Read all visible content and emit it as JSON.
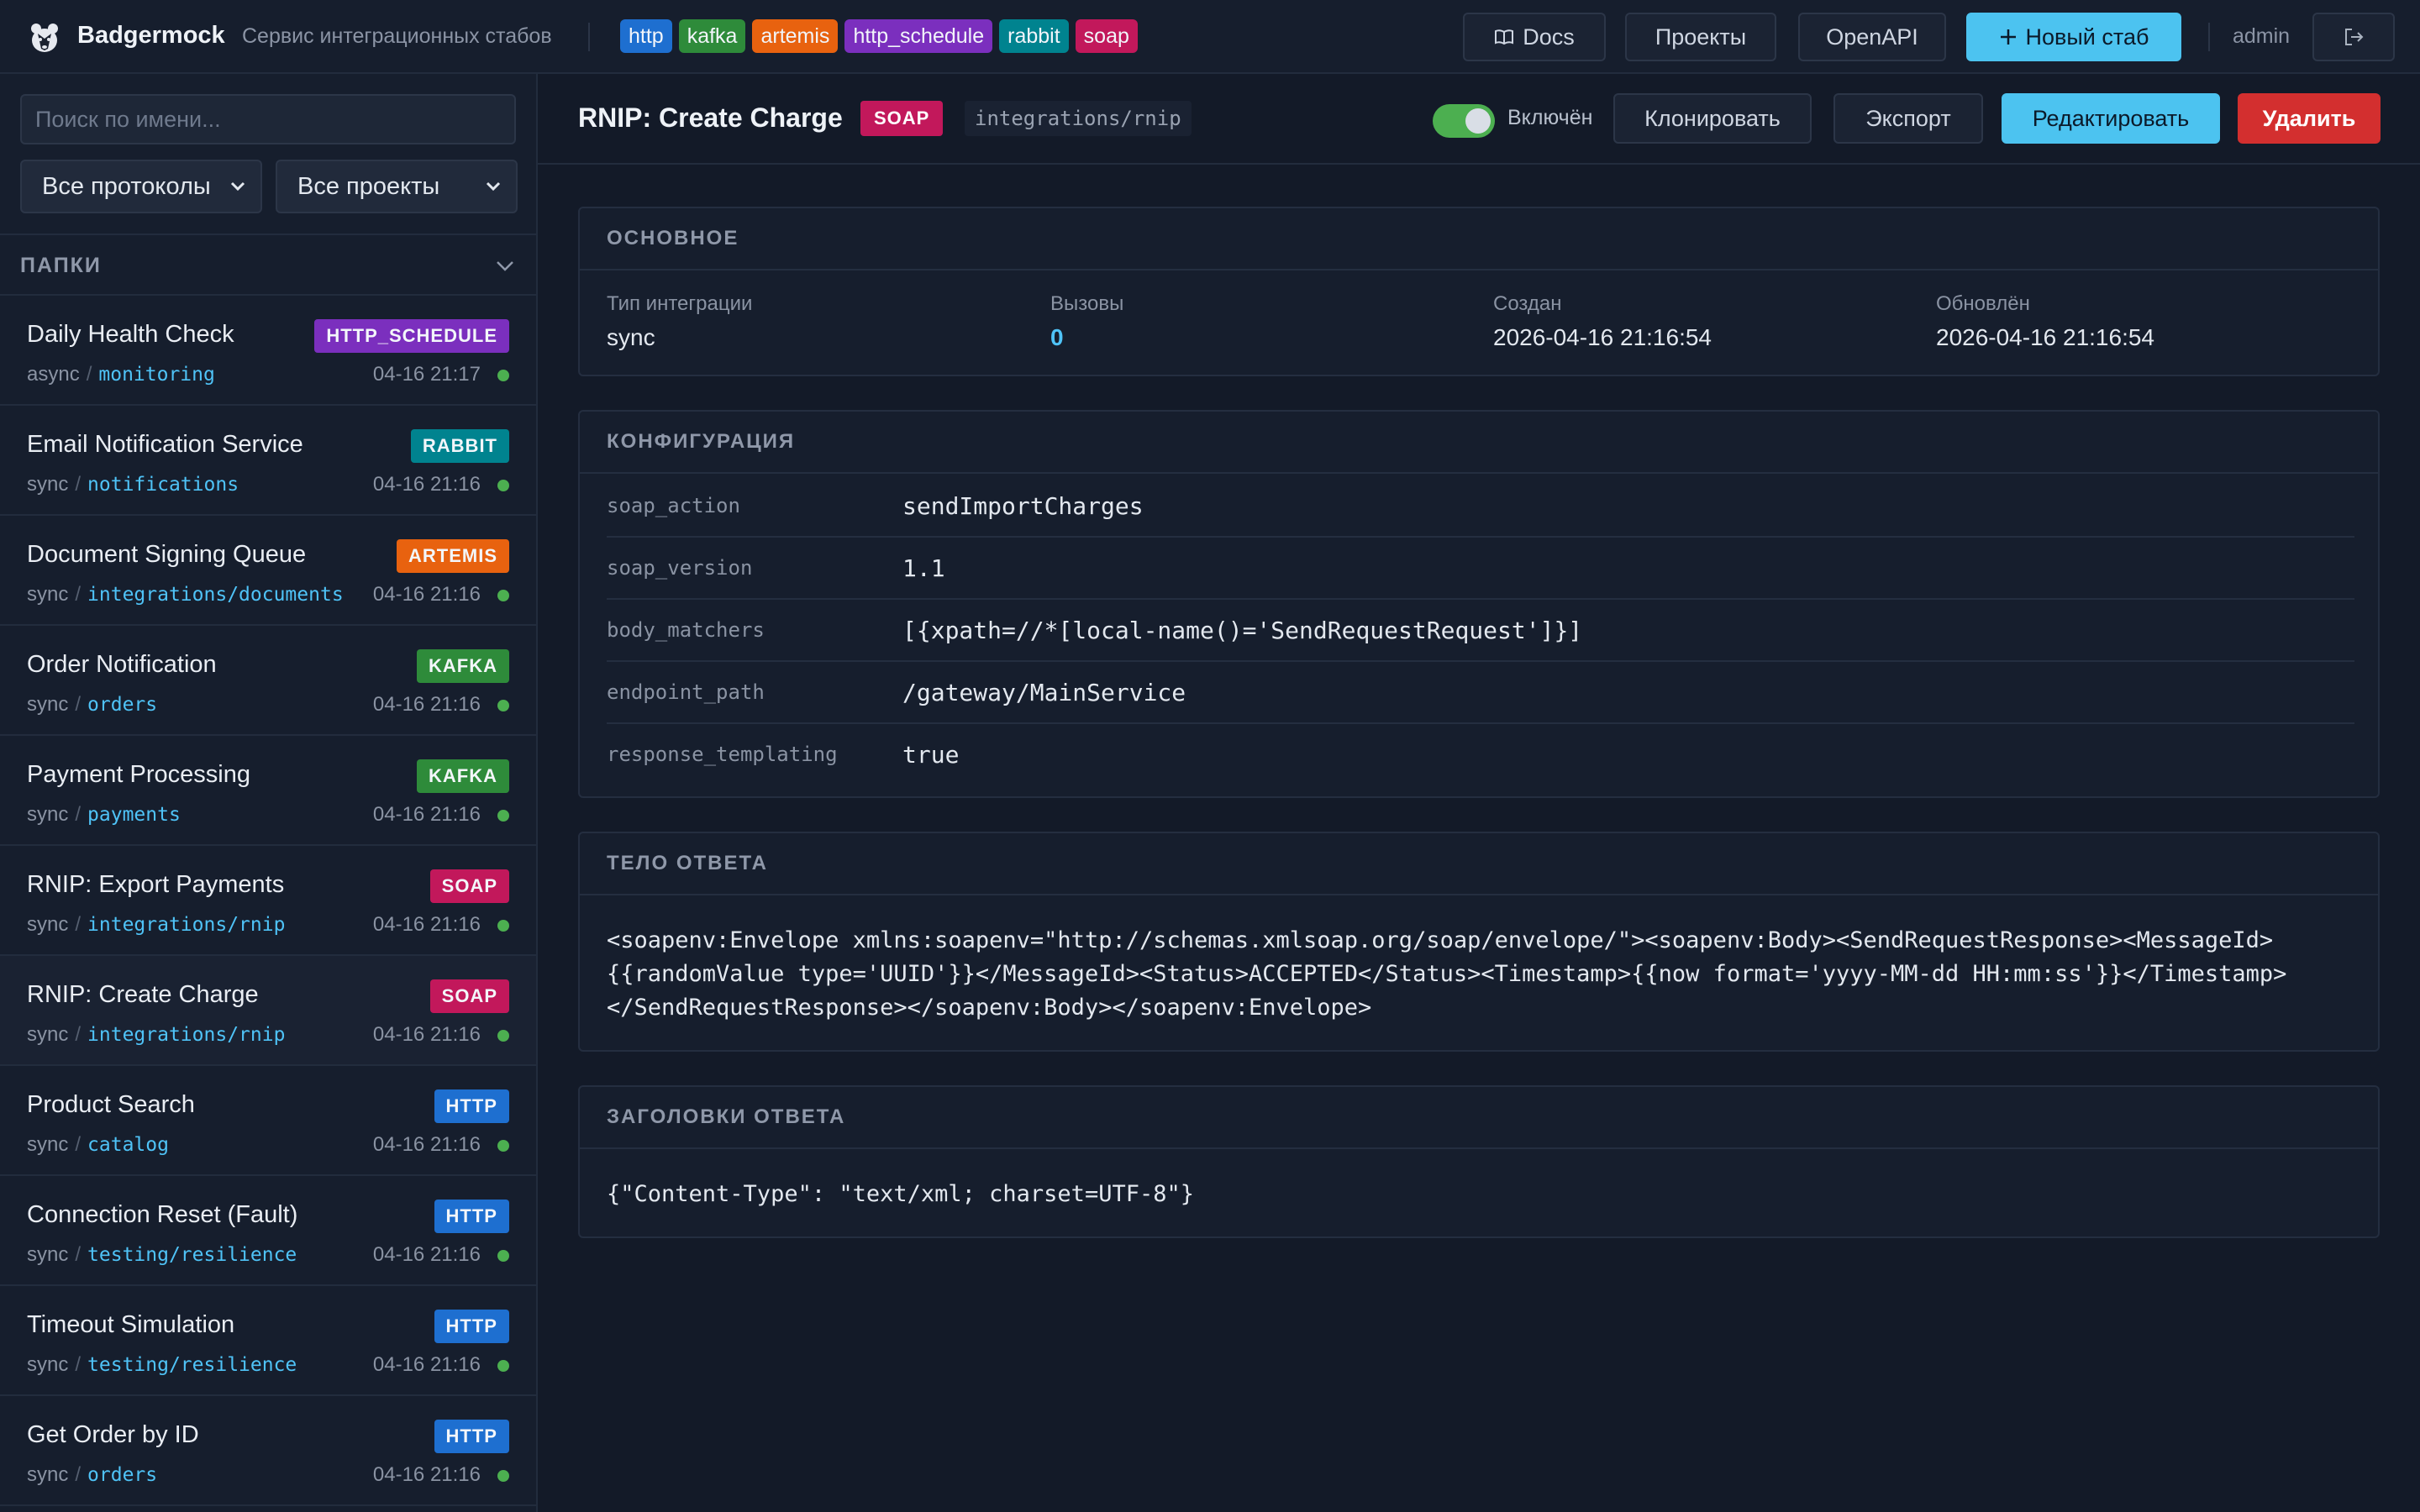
{
  "header": {
    "brand": "Badgermock",
    "subtitle": "Сервис интеграционных стабов",
    "protocols": [
      {
        "label": "http",
        "color": "#1e6fd0"
      },
      {
        "label": "kafka",
        "color": "#2e8b3a"
      },
      {
        "label": "artemis",
        "color": "#e8620f"
      },
      {
        "label": "http_schedule",
        "color": "#7b2fbe"
      },
      {
        "label": "rabbit",
        "color": "#00838f"
      },
      {
        "label": "soap",
        "color": "#c2185b"
      }
    ],
    "docs_label": "Docs",
    "projects_label": "Проекты",
    "openapi_label": "OpenAPI",
    "new_stub_label": "Новый стаб",
    "user": "admin"
  },
  "sidebar": {
    "search_placeholder": "Поиск по имени...",
    "protocol_filter": "Все протоколы",
    "project_filter": "Все проекты",
    "folders_label": "ПАПКИ",
    "stubs": [
      {
        "name": "Daily Health Check",
        "badge": "HTTP_SCHEDULE",
        "badge_color": "#7b2fbe",
        "type": "async",
        "folder": "monitoring",
        "time": "04-16 21:17"
      },
      {
        "name": "Email Notification Service",
        "badge": "RABBIT",
        "badge_color": "#00838f",
        "type": "sync",
        "folder": "notifications",
        "time": "04-16 21:16"
      },
      {
        "name": "Document Signing Queue",
        "badge": "ARTEMIS",
        "badge_color": "#e8620f",
        "type": "sync",
        "folder": "integrations/documents",
        "time": "04-16 21:16"
      },
      {
        "name": "Order Notification",
        "badge": "KAFKA",
        "badge_color": "#2e8b3a",
        "type": "sync",
        "folder": "orders",
        "time": "04-16 21:16"
      },
      {
        "name": "Payment Processing",
        "badge": "KAFKA",
        "badge_color": "#2e8b3a",
        "type": "sync",
        "folder": "payments",
        "time": "04-16 21:16"
      },
      {
        "name": "RNIP: Export Payments",
        "badge": "SOAP",
        "badge_color": "#c2185b",
        "type": "sync",
        "folder": "integrations/rnip",
        "time": "04-16 21:16"
      },
      {
        "name": "RNIP: Create Charge",
        "badge": "SOAP",
        "badge_color": "#c2185b",
        "type": "sync",
        "folder": "integrations/rnip",
        "time": "04-16 21:16"
      },
      {
        "name": "Product Search",
        "badge": "HTTP",
        "badge_color": "#1e6fd0",
        "type": "sync",
        "folder": "catalog",
        "time": "04-16 21:16"
      },
      {
        "name": "Connection Reset (Fault)",
        "badge": "HTTP",
        "badge_color": "#1e6fd0",
        "type": "sync",
        "folder": "testing/resilience",
        "time": "04-16 21:16"
      },
      {
        "name": "Timeout Simulation",
        "badge": "HTTP",
        "badge_color": "#1e6fd0",
        "type": "sync",
        "folder": "testing/resilience",
        "time": "04-16 21:16"
      },
      {
        "name": "Get Order by ID",
        "badge": "HTTP",
        "badge_color": "#1e6fd0",
        "type": "sync",
        "folder": "orders",
        "time": "04-16 21:16"
      }
    ]
  },
  "stub": {
    "title": "RNIP: Create Charge",
    "protocol": "SOAP",
    "path": "integrations/rnip",
    "enabled_label": "Включён",
    "clone_label": "Клонировать",
    "export_label": "Экспорт",
    "edit_label": "Редактировать",
    "delete_label": "Удалить"
  },
  "basic": {
    "title": "ОСНОВНОЕ",
    "type_key": "Тип интеграции",
    "type_val": "sync",
    "calls_key": "Вызовы",
    "calls_val": "0",
    "created_key": "Создан",
    "created_val": "2026-04-16 21:16:54",
    "updated_key": "Обновлён",
    "updated_val": "2026-04-16 21:16:54"
  },
  "config": {
    "title": "КОНФИГУРАЦИЯ",
    "rows": [
      {
        "key": "soap_action",
        "value": "sendImportCharges"
      },
      {
        "key": "soap_version",
        "value": "1.1"
      },
      {
        "key": "body_matchers",
        "value": "[{xpath=//*[local-name()='SendRequestRequest']}]"
      },
      {
        "key": "endpoint_path",
        "value": "/gateway/MainService"
      },
      {
        "key": "response_templating",
        "value": "true"
      }
    ]
  },
  "response_body": {
    "title": "ТЕЛО ОТВЕТА",
    "line1": "<soapenv:Envelope xmlns:soapenv=\"http://schemas.xmlsoap.org/soap/envelope/\"><soapenv:Body><SendRequestResponse><MessageId>",
    "line2": "{{randomValue type='UUID'}}</MessageId><Status>ACCEPTED</Status><Timestamp>{{now format='yyyy-MM-dd HH:mm:ss'}}</Timestamp>",
    "line3": "</SendRequestResponse></soapenv:Body></soapenv:Envelope>"
  },
  "response_headers": {
    "title": "ЗАГОЛОВКИ ОТВЕТА",
    "value": "{\"Content-Type\": \"text/xml; charset=UTF-8\"}"
  }
}
